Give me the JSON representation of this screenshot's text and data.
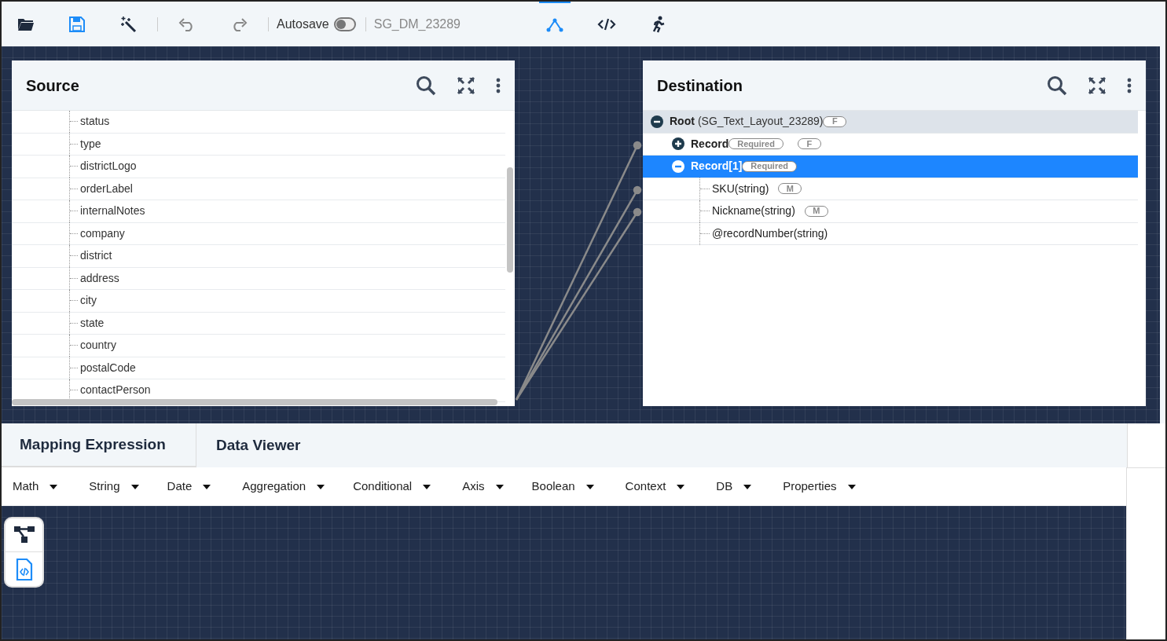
{
  "toolbar": {
    "autosave": {
      "label": "Autosave",
      "on": false
    },
    "document_name": "SG_DM_23289",
    "views": [
      {
        "kind": "mapping",
        "selected": true
      },
      {
        "kind": "code",
        "selected": false
      },
      {
        "kind": "run",
        "selected": false
      }
    ]
  },
  "source": {
    "title": "Source",
    "items": [
      "status",
      "type",
      "districtLogo",
      "orderLabel",
      "internalNotes",
      "company",
      "district",
      "address",
      "city",
      "state",
      "country",
      "postalCode",
      "contactPerson"
    ]
  },
  "destination": {
    "title": "Destination",
    "tree": [
      {
        "label": "Root",
        "detail": "(SG_Text_Layout_23289)",
        "badges": [
          "F"
        ],
        "expanded": true,
        "selected": false,
        "children": [
          {
            "label": "Record",
            "badges": [
              "Required",
              "F"
            ],
            "expanded": false,
            "selected": false
          },
          {
            "label": "Record[1]",
            "badges": [
              "Required"
            ],
            "expanded": true,
            "selected": true,
            "children": [
              {
                "label": "SKU(string)",
                "badges": [
                  "M"
                ],
                "selected": false
              },
              {
                "label": "Nickname(string)",
                "badges": [
                  "M"
                ],
                "selected": false
              },
              {
                "label": "@recordNumber(string)",
                "selected": false
              }
            ]
          }
        ]
      }
    ]
  },
  "bottom_tabs": [
    {
      "label": "Mapping Expression",
      "selected": true
    },
    {
      "label": "Data Viewer",
      "selected": false
    }
  ],
  "function_menus": [
    "Math",
    "String",
    "Date",
    "Aggregation",
    "Conditional",
    "Axis",
    "Boolean",
    "Context",
    "DB",
    "Properties"
  ]
}
